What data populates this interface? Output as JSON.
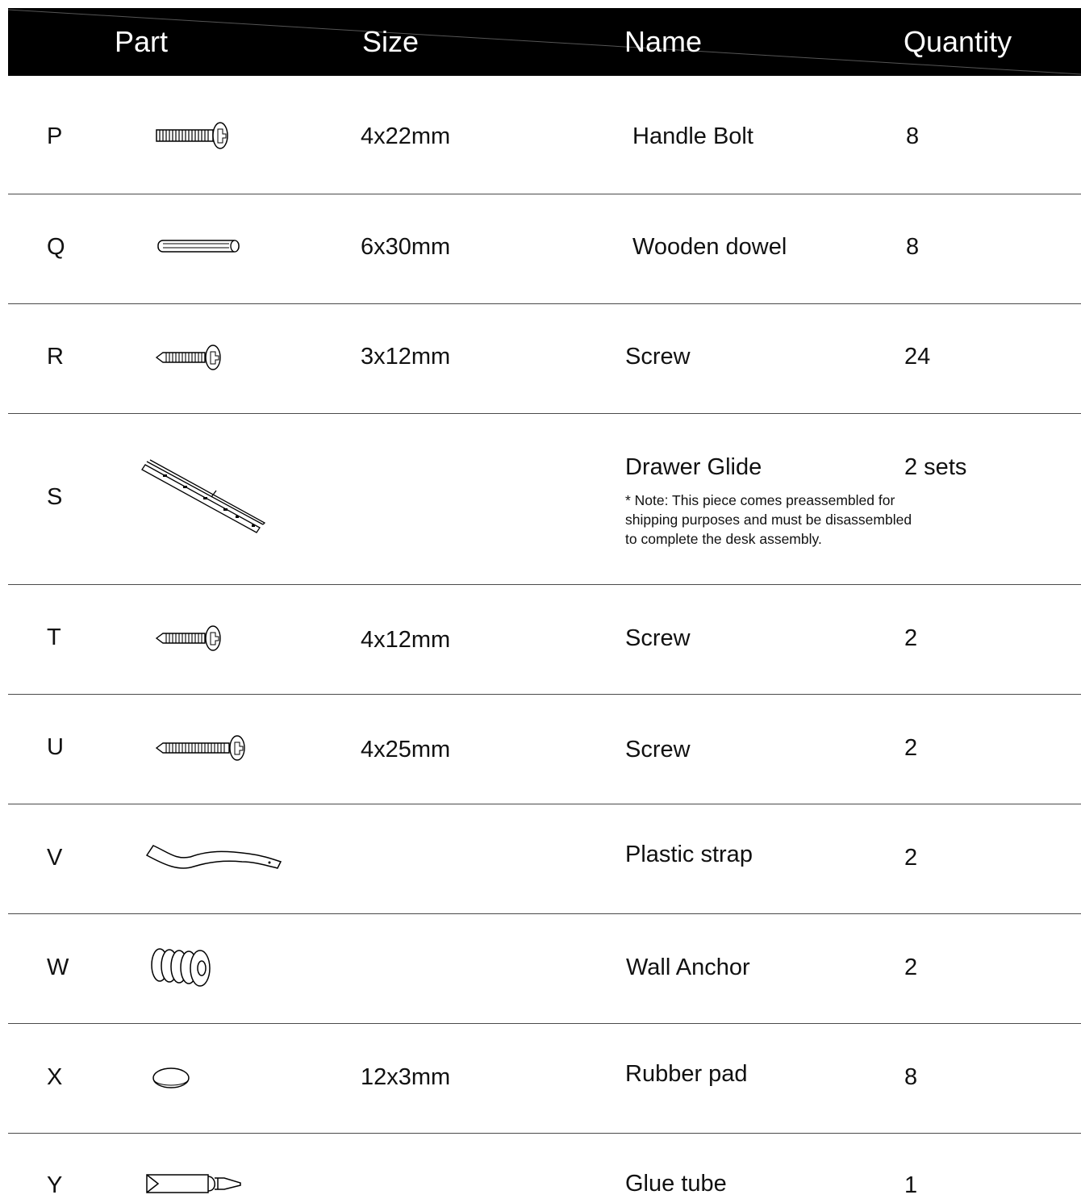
{
  "header": {
    "part": "Part",
    "size": "Size",
    "name": "Name",
    "quantity": "Quantity"
  },
  "rows": [
    {
      "letter": "P",
      "icon": "bolt-icon",
      "size": "4x22mm",
      "name": "Handle Bolt",
      "qty": "8"
    },
    {
      "letter": "Q",
      "icon": "dowel-icon",
      "size": "6x30mm",
      "name": "Wooden dowel",
      "qty": "8"
    },
    {
      "letter": "R",
      "icon": "screw-icon",
      "size": "3x12mm",
      "name": "Screw",
      "qty": "24"
    },
    {
      "letter": "S",
      "icon": "drawer-glide-icon",
      "size": "",
      "name": "Drawer Glide",
      "qty": "2 sets",
      "note": [
        "* Note: This piece comes preassembled for",
        "shipping purposes and must be disassembled",
        "to complete the desk assembly."
      ]
    },
    {
      "letter": "T",
      "icon": "screw-icon",
      "size": "4x12mm",
      "name": "Screw",
      "qty": "2"
    },
    {
      "letter": "U",
      "icon": "long-screw-icon",
      "size": "4x25mm",
      "name": "Screw",
      "qty": "2"
    },
    {
      "letter": "V",
      "icon": "plastic-strap-icon",
      "size": "",
      "name": "Plastic strap",
      "qty": "2"
    },
    {
      "letter": "W",
      "icon": "wall-anchor-icon",
      "size": "",
      "name": "Wall Anchor",
      "qty": "2"
    },
    {
      "letter": "X",
      "icon": "rubber-pad-icon",
      "size": "12x3mm",
      "name": "Rubber pad",
      "qty": "8"
    },
    {
      "letter": "Y",
      "icon": "glue-tube-icon",
      "size": "",
      "name": "Glue tube",
      "qty": "1"
    }
  ]
}
